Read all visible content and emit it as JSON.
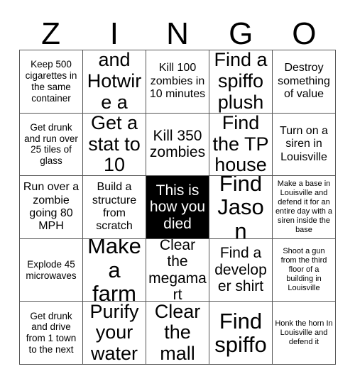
{
  "card": {
    "title_letters": [
      "Z",
      "I",
      "N",
      "G",
      "O"
    ],
    "columns": 5,
    "rows": 5,
    "colors": {
      "background": "#ffffff",
      "border": "#555555",
      "text": "#000000",
      "marked_background": "#000000",
      "marked_text": "#ffffff"
    },
    "cells": [
      {
        "text": "Keep 500 cigarettes in the same container",
        "size": "sm",
        "marked": false
      },
      {
        "text": "Find and Hotwire a car",
        "size": "xl",
        "marked": false
      },
      {
        "text": "Kill 100 zombies in 10 minutes",
        "size": "md",
        "marked": false
      },
      {
        "text": "Find a spiffo plush",
        "size": "xl",
        "marked": false
      },
      {
        "text": "Destroy something of value",
        "size": "md",
        "marked": false
      },
      {
        "text": "Get drunk and run over 25 tiles of glass",
        "size": "sm",
        "marked": false
      },
      {
        "text": "Get a stat to 10",
        "size": "xl",
        "marked": false
      },
      {
        "text": "Kill 350 zombies",
        "size": "lg",
        "marked": false
      },
      {
        "text": "Find the TP house",
        "size": "xl",
        "marked": false
      },
      {
        "text": "Turn on a siren in Louisville",
        "size": "md",
        "marked": false
      },
      {
        "text": "Run over a zombie going 80 MPH",
        "size": "md",
        "marked": false
      },
      {
        "text": "Build a structure from scratch",
        "size": "md",
        "marked": false
      },
      {
        "text": "This is how you died",
        "size": "lg",
        "marked": true
      },
      {
        "text": "Find Jason",
        "size": "xxl",
        "marked": false
      },
      {
        "text": "Make a base in Louisville and defend it for an entire day with a siren inside the base",
        "size": "xs",
        "marked": false
      },
      {
        "text": "Explode 45 microwaves",
        "size": "sm",
        "marked": false
      },
      {
        "text": "Make a farm",
        "size": "xxl",
        "marked": false
      },
      {
        "text": "Clear the megamart",
        "size": "lg",
        "marked": false
      },
      {
        "text": "Find a developer shirt",
        "size": "lg",
        "marked": false
      },
      {
        "text": "Shoot a gun from the third floor of a building in Louisville",
        "size": "xs",
        "marked": false
      },
      {
        "text": "Get drunk and drive from 1 town to the next",
        "size": "sm",
        "marked": false
      },
      {
        "text": "Purify your water",
        "size": "xl",
        "marked": false
      },
      {
        "text": "Clear the mall",
        "size": "xl",
        "marked": false
      },
      {
        "text": "Find spiffo",
        "size": "xxl",
        "marked": false
      },
      {
        "text": "Honk the horn In Louisville and defend it",
        "size": "xs",
        "marked": false
      }
    ]
  }
}
